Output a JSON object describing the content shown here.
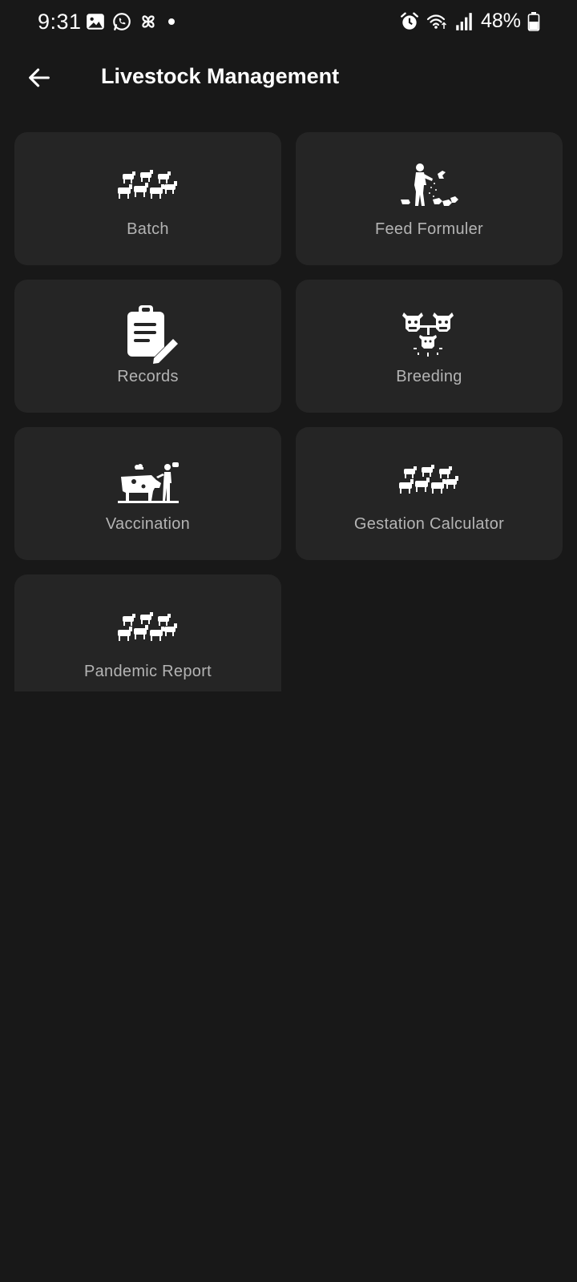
{
  "status_bar": {
    "time": "9:31",
    "battery": "48%",
    "left_icons": [
      "gallery-icon",
      "whatsapp-icon",
      "pinwheel-icon",
      "dot-icon"
    ],
    "right_icons": [
      "alarm-icon",
      "wifi-icon",
      "signal-icon",
      "battery-icon"
    ]
  },
  "app_bar": {
    "title": "Livestock Management",
    "back_icon": "arrow-left-icon"
  },
  "cards": [
    {
      "label": "Batch",
      "icon": "herd-icon"
    },
    {
      "label": "Feed Formuler",
      "icon": "farmer-feeding-icon"
    },
    {
      "label": "Records",
      "icon": "clipboard-edit-icon"
    },
    {
      "label": "Breeding",
      "icon": "cow-breeding-icon"
    },
    {
      "label": "Vaccination",
      "icon": "cow-vaccination-icon"
    },
    {
      "label": "Gestation Calculator",
      "icon": "herd-icon"
    },
    {
      "label": "Pandemic Report",
      "icon": "herd-icon"
    }
  ],
  "colors": {
    "background": "#181818",
    "card": "#252525",
    "label": "#b4b4b4",
    "title": "#ffffff"
  }
}
